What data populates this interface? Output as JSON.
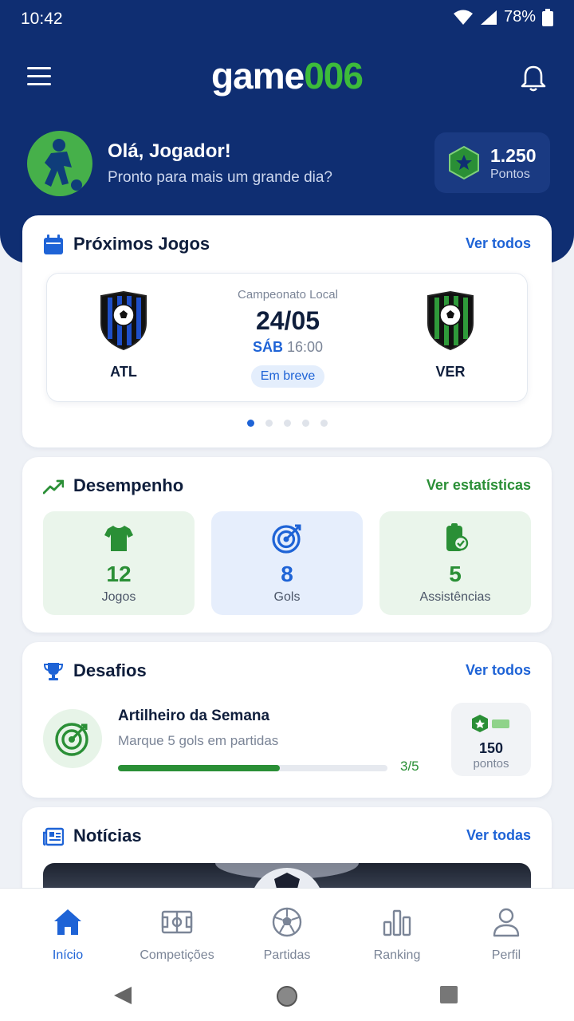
{
  "status_bar": {
    "time": "10:42",
    "battery": "78%"
  },
  "header": {
    "logo_part1": "game",
    "logo_part2": "006",
    "menu_icon": "hamburger-menu-icon",
    "bell_icon": "bell-icon"
  },
  "user": {
    "greeting": "Olá, Jogador!",
    "subtitle": "Pronto para mais um grande dia?",
    "points_value": "1.250",
    "points_label": "Pontos"
  },
  "upcoming": {
    "title": "Próximos Jogos",
    "link": "Ver todos",
    "match": {
      "competition": "Campeonato Local",
      "date": "24/05",
      "day": "SÁB",
      "time": "16:00",
      "badge": "Em breve",
      "home": {
        "name": "ATL",
        "color": "#1e4fc9"
      },
      "away": {
        "name": "VER",
        "color": "#2f9a3a"
      }
    },
    "pagination": {
      "pages": 5,
      "current": 1
    }
  },
  "performance": {
    "title": "Desempenho",
    "link": "Ver estatísticas",
    "stats": [
      {
        "value": "12",
        "label": "Jogos",
        "icon": "jersey-icon",
        "color": "#2a8f36"
      },
      {
        "value": "8",
        "label": "Gols",
        "icon": "target-icon",
        "color": "#1e63d6"
      },
      {
        "value": "5",
        "label": "Assistências",
        "icon": "assist-icon",
        "color": "#2a8f36"
      }
    ]
  },
  "challenges": {
    "title": "Desafios",
    "link": "Ver todos",
    "item": {
      "title": "Artilheiro da Semana",
      "description": "Marque 5 gols em partidas",
      "progress_text": "3/5",
      "progress": 0.6,
      "reward_value": "150",
      "reward_label": "pontos"
    }
  },
  "news": {
    "title": "Notícias",
    "link": "Ver todas"
  },
  "bottom_nav": [
    {
      "label": "Início",
      "icon": "home-icon",
      "active": true
    },
    {
      "label": "Competições",
      "icon": "field-icon",
      "active": false
    },
    {
      "label": "Partidas",
      "icon": "soccer-ball-icon",
      "active": false
    },
    {
      "label": "Ranking",
      "icon": "bar-chart-icon",
      "active": false
    },
    {
      "label": "Perfil",
      "icon": "user-icon",
      "active": false
    }
  ],
  "colors": {
    "primary": "#0f2e72",
    "accent_blue": "#1e63d6",
    "accent_green": "#2a8f36"
  }
}
